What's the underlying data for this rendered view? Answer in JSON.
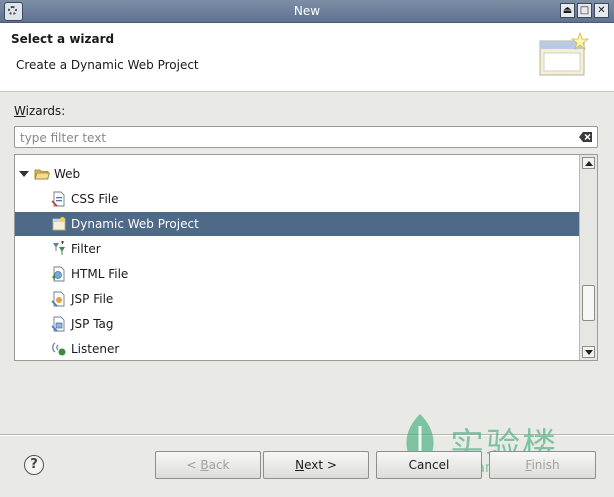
{
  "window": {
    "title": "New"
  },
  "banner": {
    "title": "Select a wizard",
    "description": "Create a Dynamic Web Project"
  },
  "wizards": {
    "label_mnemonic": "W",
    "label_rest": "izards:"
  },
  "filter": {
    "placeholder": "type filter text",
    "value": ""
  },
  "tree": {
    "items": [
      {
        "label": "Web",
        "icon": "folder-open-icon",
        "expanded": true,
        "selected": false
      },
      {
        "label": "CSS File",
        "icon": "css-file-icon",
        "selected": false
      },
      {
        "label": "Dynamic Web Project",
        "icon": "web-project-icon",
        "selected": true
      },
      {
        "label": "Filter",
        "icon": "filter-icon",
        "selected": false
      },
      {
        "label": "HTML File",
        "icon": "html-file-icon",
        "selected": false
      },
      {
        "label": "JSP File",
        "icon": "jsp-file-icon",
        "selected": false
      },
      {
        "label": "JSP Tag",
        "icon": "jsp-tag-icon",
        "selected": false
      },
      {
        "label": "Listener",
        "icon": "listener-icon",
        "selected": false
      }
    ]
  },
  "buttons": {
    "back_prefix": "< ",
    "back_mnemonic": "B",
    "back_rest": "ack",
    "next_mnemonic": "N",
    "next_rest": "ext >",
    "cancel": "Cancel",
    "finish_mnemonic": "F",
    "finish_rest": "inish"
  },
  "watermark": {
    "text": "实验楼",
    "subtext": "shiyanlou.com"
  },
  "colors": {
    "selection": "#4e6a88",
    "titlebar": "#6a7c97",
    "watermark": "#27a56a"
  }
}
